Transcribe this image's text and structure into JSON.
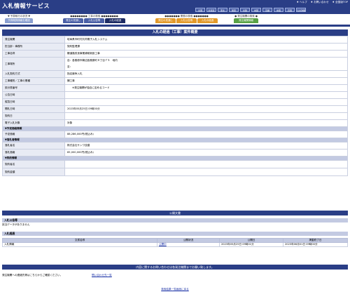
{
  "header": {
    "logo": "入札情報サービス",
    "top_links": [
      "♦ ヘルプ",
      "♦ お問い合わせ",
      "♦ 全国版TOP"
    ],
    "prefectures": [
      "全国",
      "北海道",
      "東北",
      "関東",
      "北陸",
      "中部",
      "近畿",
      "中国",
      "四国",
      "九州沖縄"
    ]
  },
  "nav": {
    "groups": [
      {
        "title": "▼ 予算執行の状況 ▼",
        "tabs": [
          "予算概算情報を確認"
        ],
        "color": "#8a9fd0"
      },
      {
        "title": "●●●●●●●● 工事の検索 ●●●●●●●●",
        "tabs": [
          "発注の見通し",
          "入札公告等",
          "入札の経過"
        ],
        "color": "#4a5fa6",
        "active": 2
      },
      {
        "title": "●●●●●●● 業務の検索 ●●●●●●●",
        "tabs": [
          "発注の見通し",
          "入札公告等",
          "入札の経過"
        ],
        "color": "#e39a2a"
      },
      {
        "title": "● 発注機関の検索 ●",
        "tabs": [
          "発注機関情報"
        ],
        "color": "#5aa246"
      }
    ]
  },
  "page": {
    "title": "入札の経過（工事）案件概要",
    "rows": [
      {
        "k": "発注機関",
        "v": "岐阜県市町村共同電子入札システム"
      },
      {
        "k": "担当部・事務所",
        "v": "契約監理課"
      },
      {
        "k": "工事名称",
        "v": "糠道路改良事業補助新設工事"
      },
      {
        "k": "工事場所",
        "v": "自：各務原市鵜沼各務原町８丁目７５　地内",
        "v2": "至："
      },
      {
        "k": "入札契約方式",
        "v": "指名競争入札"
      },
      {
        "k": "工事種別／工事の業種",
        "v": "舗工事"
      },
      {
        "k": "設計書番号",
        "v": "　　※発注機関が独自に定めるコード"
      },
      {
        "k": "公告日時",
        "v": ""
      },
      {
        "k": "縦覧日時",
        "v": ""
      },
      {
        "k": "開札日時",
        "v": "2023年05月25日 09時00分"
      },
      {
        "k": "契約日",
        "v": ""
      },
      {
        "k": "電子入札対象",
        "v": "対象"
      }
    ],
    "section_yotei": "▼予定価格情報",
    "yotei_label": "予定価格",
    "yotei_value": "88,286,000円(税込み)",
    "section_rakusatsu": "▼落札者情報",
    "rakusatsu_rows": [
      {
        "k": "落札者名",
        "v": "株式会社サンワ技建"
      },
      {
        "k": "落札価格",
        "v": "85,000,000円(税込み)"
      }
    ],
    "section_keiyaku": "▼契約情報",
    "keiyaku_rows": [
      {
        "k": "契約者名",
        "v": ""
      },
      {
        "k": "契約金額",
        "v": ""
      }
    ]
  },
  "public_docs": {
    "header": "公開文書",
    "notice_title": "入札公告等",
    "notice_text": "該当データがありません",
    "history_title": "入札経過",
    "columns": [
      "文書名称",
      "公開状況",
      "公開日",
      "掲載終了日"
    ],
    "rows": [
      {
        "name": "入札情報",
        "status": "公開中",
        "date": "2023年05月25日 09時01分",
        "end": "2023年06月01日 09時00分"
      }
    ]
  },
  "contact": {
    "header": "内容に関するお問い合わせは各発注機関までお願い致します。",
    "text": "発注機関への連絡先等はこちらからご確認ください。",
    "link": "問い合わせ先一覧"
  },
  "footer": {
    "link": "検索結果一覧画面に戻る"
  }
}
